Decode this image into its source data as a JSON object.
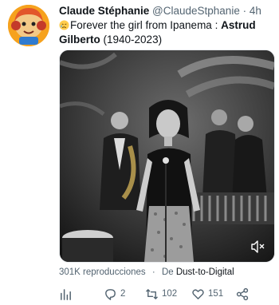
{
  "tweet": {
    "author_name": "Claude Stéphanie",
    "author_handle": "@ClaudeStphanie",
    "separator": "·",
    "time": "4h",
    "text_before": "Forever the girl from Ipanema : ",
    "text_bold": "Astrud Gilberto",
    "text_after": " (1940-2023)",
    "emoji_icon": "crying-face-icon"
  },
  "media": {
    "views": "301K reproducciones",
    "dot": "·",
    "source_prefix": "De",
    "source_name": "Dust-to-Digital"
  },
  "actions": {
    "analytics_icon": "analytics-icon",
    "reply_count": "2",
    "retweet_count": "102",
    "like_count": "151",
    "share_icon": "share-icon"
  },
  "colors": {
    "text": "#0f1419",
    "secondary": "#536471",
    "avatar_bg": "#f6a21e"
  }
}
